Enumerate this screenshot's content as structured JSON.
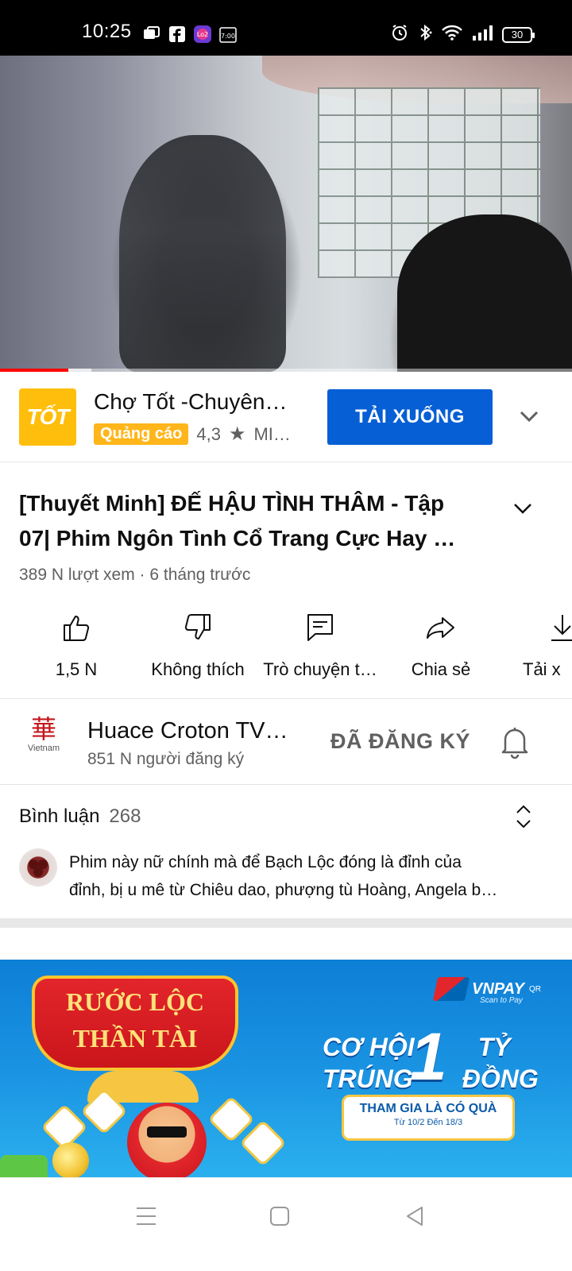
{
  "status_bar": {
    "time": "10:25",
    "app_icons": [
      "messages-icon",
      "facebook-icon",
      "lo2-app-icon",
      "calendar-icon"
    ],
    "lo2_label": "Lo2",
    "calendar_label": "7:00",
    "right_icons": [
      "alarm-icon",
      "bluetooth-icon",
      "wifi-icon",
      "signal-icon",
      "battery-icon"
    ],
    "battery": "30"
  },
  "player": {
    "progress_played": 0.12,
    "progress_buffered": 0.16,
    "progress_color": "#ff0000"
  },
  "ad": {
    "logo_text": "TỐT",
    "title": "Chợ Tốt -Chuyên…",
    "badge": "Quảng cáo",
    "rating": "4,3",
    "category": "MI…",
    "cta": "TẢI XUỐNG",
    "cta_color": "#065fd4",
    "badge_color": "#ffb61a"
  },
  "video": {
    "title_line1": "[Thuyết Minh] ĐẾ HẬU TÌNH THÂM - Tập",
    "title_line2": "07| Phim Ngôn Tình Cổ Trang Cực Hay …",
    "meta": "389 N lượt xem · 6 tháng trước"
  },
  "actions": [
    {
      "icon": "like-icon",
      "label": "1,5 N"
    },
    {
      "icon": "dislike-icon",
      "label": "Không thích"
    },
    {
      "icon": "live-chat-icon",
      "label": "Trò chuyện t…"
    },
    {
      "icon": "share-icon",
      "label": "Chia sẻ"
    },
    {
      "icon": "download-icon",
      "label": "Tải x"
    }
  ],
  "channel": {
    "avatar_glyph": "華",
    "avatar_sub": "Vietnam",
    "name": "Huace Croton TV…",
    "subscribers": "851 N người đăng ký",
    "subscribed_label": "ĐÃ ĐĂNG KÝ"
  },
  "comments": {
    "title": "Bình luận",
    "count": "268",
    "top_comment_line1": "Phim này nữ chính mà để Bạch Lộc đóng là đỉnh của",
    "top_comment_line2": "đỉnh, bị u mê từ Chiêu dao, phượng tù Hoàng,  Angela b…"
  },
  "banner": {
    "ribbon_line1": "RƯỚC LỘC",
    "ribbon_line2": "THẦN TÀI",
    "brand": "VNPAY",
    "brand_suffix": "QR",
    "brand_slogan": "Scan to Pay",
    "promo_line1_left": "CƠ HỘI",
    "promo_big": "1",
    "promo_line1_right": "TỶ",
    "promo_line2_left": "TRÚNG",
    "promo_line2_right": "ĐỒNG",
    "card_line1": "THAM GIA LÀ CÓ QUÀ",
    "card_line2": "Từ 10/2 Đến 18/3",
    "bg_color": "#1a93e2"
  },
  "nav": [
    "menu-icon",
    "home-square-icon",
    "back-triangle-icon"
  ]
}
